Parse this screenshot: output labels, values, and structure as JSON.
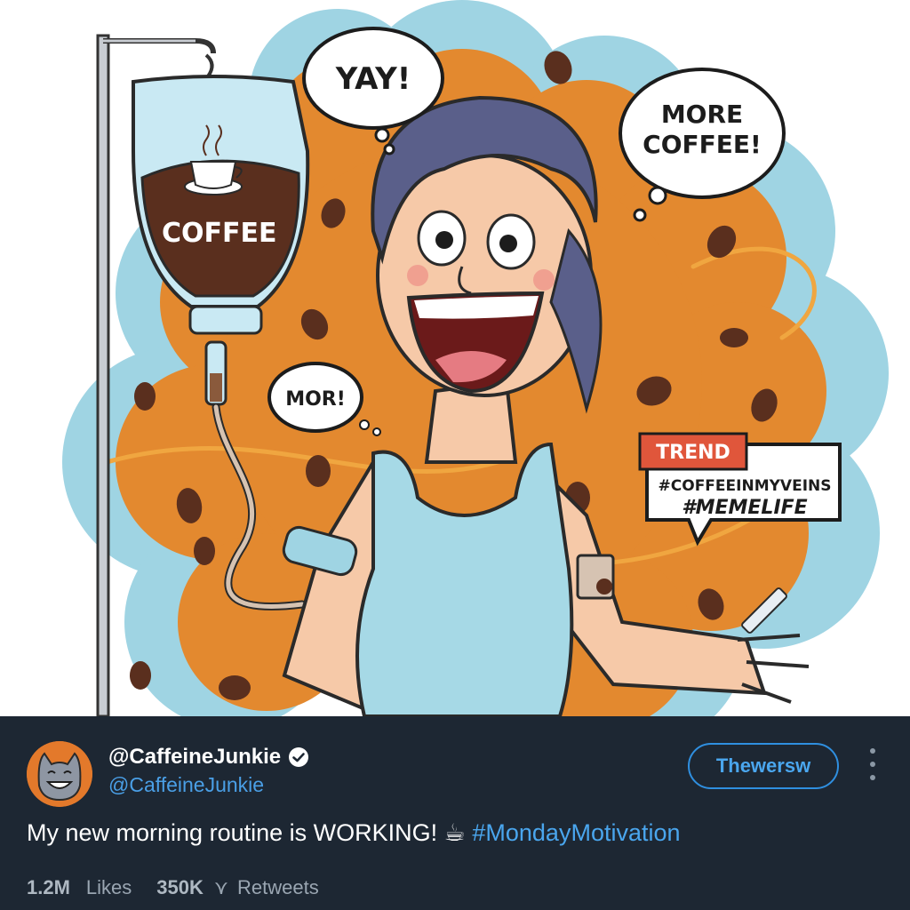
{
  "illustration": {
    "bag_label": "COFFEE",
    "bubble_yay": "YAY!",
    "bubble_more_line1": "MORE",
    "bubble_more_line2": "COFFEE!",
    "bubble_mor": "MOR!",
    "trend_label": "TREND",
    "trend_tag1": "#COFFEEINMYVEINS",
    "trend_tag2": "#MEMELIFE"
  },
  "tweet": {
    "display_name": "@CaffeineJunkie",
    "handle": "@CaffeineJunkie",
    "follow_label": "Thewersw",
    "text": "My new morning routine is WORKING!",
    "emoji": "☕",
    "hashtag": "#MondayMotivation",
    "likes_count": "1.2M",
    "likes_label": "Likes",
    "retweets_count": "350K",
    "retweets_label": "Retweets",
    "retweet_icon": "⋎"
  },
  "colors": {
    "tweet_bg": "#1d2733",
    "accent_blue": "#4aa6ee",
    "burst_orange": "#e3892f",
    "burst_blue": "#9fd4e3",
    "coffee_brown": "#5a2f1e",
    "tank_top": "#a6d9e6"
  }
}
